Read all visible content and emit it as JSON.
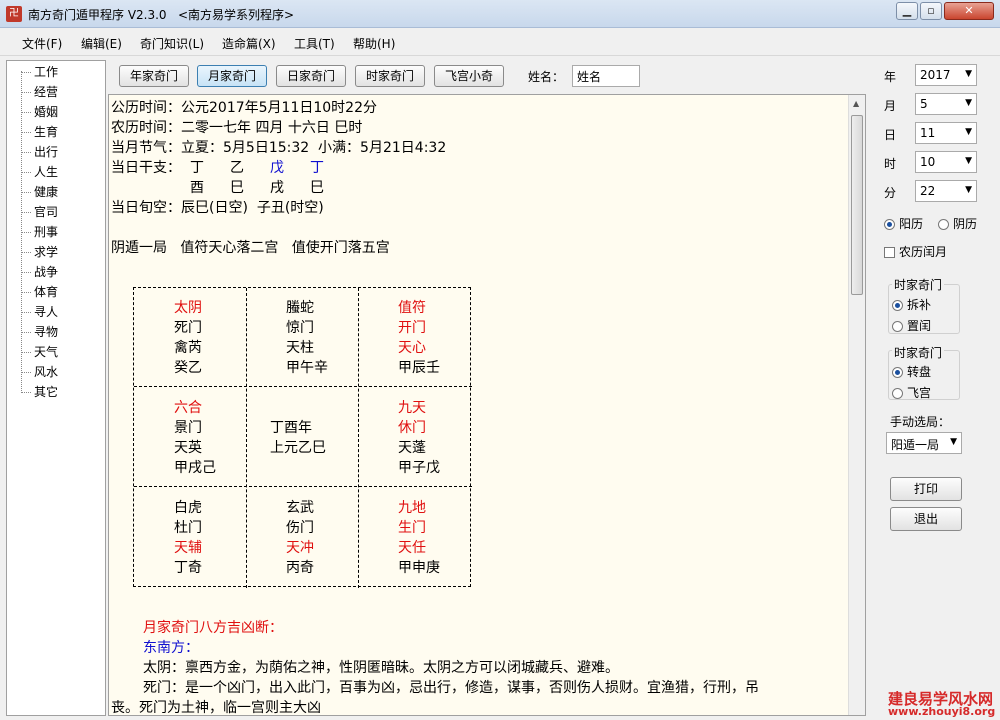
{
  "window": {
    "title": "南方奇门遁甲程序 V2.3.0",
    "subtitle": "<南方易学系列程序>",
    "icon_text": "卍"
  },
  "menu": [
    "文件(F)",
    "编辑(E)",
    "奇门知识(L)",
    "造命篇(X)",
    "工具(T)",
    "帮助(H)"
  ],
  "sidebar": {
    "items": [
      "工作",
      "经营",
      "婚姻",
      "生育",
      "出行",
      "人生",
      "健康",
      "官司",
      "刑事",
      "求学",
      "战争",
      "体育",
      "寻人",
      "寻物",
      "天气",
      "风水",
      "其它"
    ]
  },
  "toolbar": {
    "buttons": [
      "年家奇门",
      "月家奇门",
      "日家奇门",
      "时家奇门",
      "飞宫小奇"
    ],
    "name_label": "姓名：",
    "name_value": "姓名"
  },
  "content": {
    "gongli": "公历时间：公元2017年5月11日10时22分",
    "nongli": "农历时间：二零一七年 四月 十六日 巳时",
    "jieqi": "当月节气：立夏：5月5日15:32  小满：5月21日4:32",
    "ganzhi_label": "当日干支：",
    "ganzhi_top": [
      "丁",
      "乙",
      "戊",
      "丁"
    ],
    "ganzhi_bottom": [
      "酉",
      "巳",
      "戌",
      "巳"
    ],
    "xunkong": "当日旬空：辰巳(日空)  子丑(时空)",
    "ju": "阴遁一局   值符天心落二宫   值使开门落五宫",
    "grid": {
      "c00": [
        "太阴",
        "死门",
        "禽芮",
        "癸乙"
      ],
      "c01": [
        "螣蛇",
        "惊门",
        "天柱",
        "甲午辛"
      ],
      "c02": [
        "值符",
        "开门",
        "天心",
        "甲辰壬"
      ],
      "c10": [
        "六合",
        "景门",
        "天英",
        "甲戌己"
      ],
      "c11": [
        "丁酉年",
        "上元乙巳"
      ],
      "c12": [
        "九天",
        "休门",
        "天蓬",
        "甲子戊"
      ],
      "c20": [
        "白虎",
        "杜门",
        "天辅",
        "丁奇"
      ],
      "c21": [
        "玄武",
        "伤门",
        "天冲",
        "丙奇"
      ],
      "c22": [
        "九地",
        "生门",
        "天任",
        "甲申庚"
      ]
    },
    "judge_title": "月家奇门八方吉凶断：",
    "direction": "东南方：",
    "para1": "太阴：禀西方金，为荫佑之神，性阴匿暗昧。太阴之方可以闭城藏兵、避难。",
    "para2": "死门：是一个凶门，出入此门，百事为凶，忌出行，修造，谋事，否则伤人损财。宜渔猎，行刑，吊",
    "para3": "丧。死门为土神，临一宫则主大凶"
  },
  "right": {
    "year_label": "年",
    "year": "2017",
    "month_label": "月",
    "month": "5",
    "day_label": "日",
    "day": "11",
    "hour_label": "时",
    "hour": "10",
    "minute_label": "分",
    "minute": "22",
    "yangli": "阳历",
    "yinli": "阴历",
    "runyue": "农历闰月",
    "group1_title": "时家奇门",
    "chaibu": "拆补",
    "zhirun": "置闰",
    "group2_title": "时家奇门",
    "zhuanpan": "转盘",
    "feigong": "飞宫",
    "manual_label": "手动选局：",
    "manual_value": "阳遁一局",
    "print": "打印",
    "exit": "退出"
  },
  "watermark": {
    "line1": "建良易学风水网",
    "line2": "www.zhouyi8.org"
  }
}
